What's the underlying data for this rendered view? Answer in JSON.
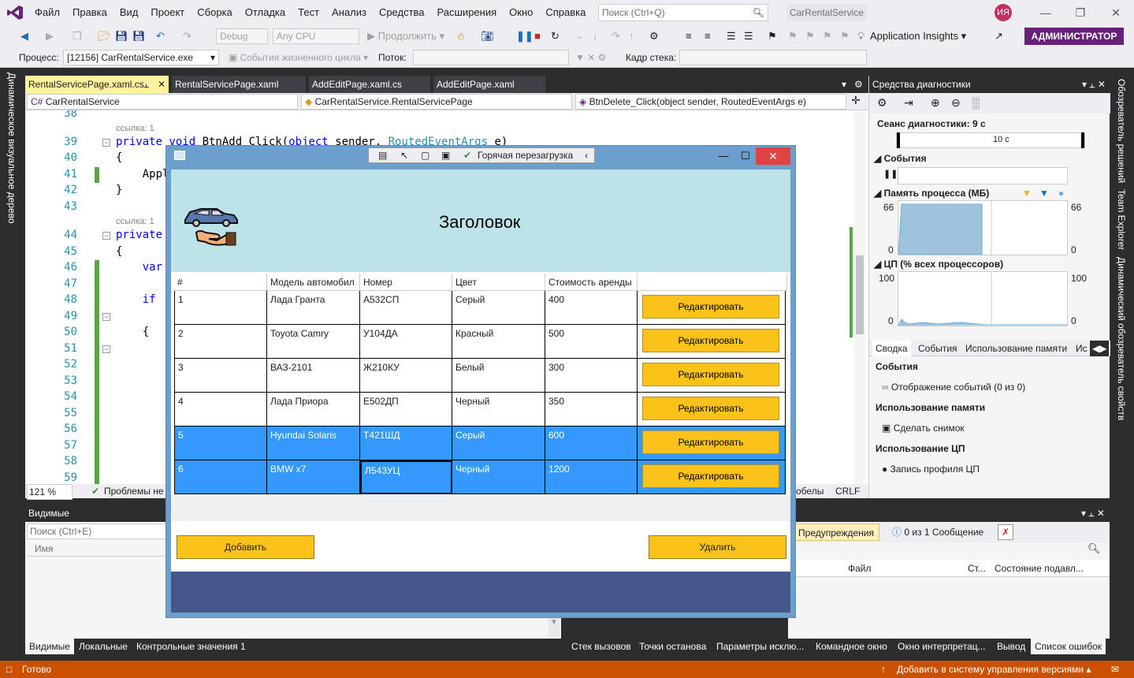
{
  "menu": {
    "items": [
      "Файл",
      "Правка",
      "Вид",
      "Проект",
      "Сборка",
      "Отладка",
      "Тест",
      "Анализ",
      "Средства",
      "Расширения",
      "Окно",
      "Справка"
    ],
    "search_placeholder": "Поиск (Ctrl+Q)",
    "project_name": "CarRentalService",
    "avatar_initials": "ИЯ"
  },
  "toolbar": {
    "config": "Debug",
    "platform": "Any CPU",
    "continue": "Продолжить",
    "app_insights": "Application Insights",
    "admin": "АДМИНИСТРАТОР"
  },
  "procbar": {
    "process_label": "Процесс:",
    "process_value": "[12156] CarRentalService.exe",
    "lifecycle": "События жизненного цикла",
    "thread": "Поток:",
    "stack": "Кадр стека:"
  },
  "left_vtab": "Динамическое визуальное дерево",
  "right_vtabs": [
    "Обозреватель решений",
    "Team Explorer",
    "Динамический обозреватель свойств"
  ],
  "editor": {
    "tabs": [
      "RentalServicePage.xaml.cs",
      "RentalServicePage.xaml",
      "AddEditPage.xaml.cs",
      "AddEditPage.xaml"
    ],
    "nav1": "CarRentalService",
    "nav2": "CarRentalService.RentalServicePage",
    "nav3": "BtnDelete_Click(object sender, RoutedEventArgs e)",
    "refs": "ссылка: 1",
    "lines": [
      "38",
      "39",
      "40",
      "41",
      "42",
      "43",
      "44",
      "45",
      "46",
      "47",
      "48",
      "49",
      "50",
      "51",
      "52",
      "53",
      "54",
      "55",
      "56",
      "57",
      "58",
      "59"
    ],
    "code": {
      "l39a": "private void ",
      "l39b": "BtnAdd_Click(",
      "l39c": "object",
      "l39d": " sender, ",
      "l39e": "RoutedEventArgs",
      "l39f": " e)",
      "l40": "{",
      "l41": "    Appl",
      "l42": "}",
      "l44": "private",
      "l45": "{",
      "l46": "    var",
      "l48": "    if",
      "l50": "    {"
    },
    "zoom": "121 %",
    "problems": "Проблемы не",
    "spaces": "обелы",
    "eol": "CRLF"
  },
  "diag": {
    "title": "Средства диагностики",
    "session": "Сеанс диагностики: 9 с",
    "tick": "10 с",
    "events": "События",
    "memory": "Память процесса (МБ)",
    "mem_max": "66",
    "mem_min": "0",
    "cpu": "ЦП (% всех процессоров)",
    "cpu_max": "100",
    "cpu_min": "0",
    "tabs": [
      "Сводка",
      "События",
      "Использование памяти",
      "Ис"
    ],
    "sec_events": "События",
    "show_events": "Отображение событий (0 из 0)",
    "sec_memory": "Использование памяти",
    "snapshot": "Сделать снимок",
    "sec_cpu": "Использование ЦП",
    "cpu_profile": "Запись профиля ЦП"
  },
  "watch": {
    "title": "Видимые",
    "search_placeholder": "Поиск (Ctrl+E)",
    "col_name": "Имя"
  },
  "errors": {
    "warnings": "Предупреждения",
    "messages": "0 из 1 Сообщение",
    "col_file": "Файл",
    "col_line": "Ст...",
    "col_state": "Состояние подавл..."
  },
  "bottom_tabs_left": [
    "Видимые",
    "Локальные",
    "Контрольные значения 1"
  ],
  "bottom_tabs_right": [
    "Стек вызовов",
    "Точки останова",
    "Параметры исклю...",
    "Командное окно",
    "Окно интерпретац...",
    "Вывод",
    "Список ошибок"
  ],
  "status": {
    "ready": "Готово",
    "vcs": "Добавить в систему управления версиями"
  },
  "app": {
    "hot_reload": "Горячая перезагрузка",
    "header_title": "Заголовок",
    "columns": [
      "#",
      "Модель автомобил",
      "Номер",
      "Цвет",
      "Стоимость аренды"
    ],
    "rows": [
      {
        "n": "1",
        "model": "Лада Гранта",
        "plate": "А532СП",
        "color": "Серый",
        "price": "400"
      },
      {
        "n": "2",
        "model": "Toyota Camry",
        "plate": "У104ДА",
        "color": "Красный",
        "price": "500"
      },
      {
        "n": "3",
        "model": "ВАЗ-2101",
        "plate": "Ж210КУ",
        "color": "Белый",
        "price": "300"
      },
      {
        "n": "4",
        "model": "Лада Приора",
        "plate": "Е502ДП",
        "color": "Черный",
        "price": "350"
      },
      {
        "n": "5",
        "model": "Hyundai Solaris",
        "plate": "Т421ШД",
        "color": "Серый",
        "price": "600"
      },
      {
        "n": "6",
        "model": "BMW x7",
        "plate": "Л543УЦ",
        "color": "Черный",
        "price": "1200"
      }
    ],
    "edit_label": "Редактировать",
    "add_label": "Добавить",
    "delete_label": "Удалить",
    "accent": "#fbc319",
    "footer_color": "#44578b",
    "header_color": "#bde3e8",
    "selection_color": "#3399ff"
  }
}
